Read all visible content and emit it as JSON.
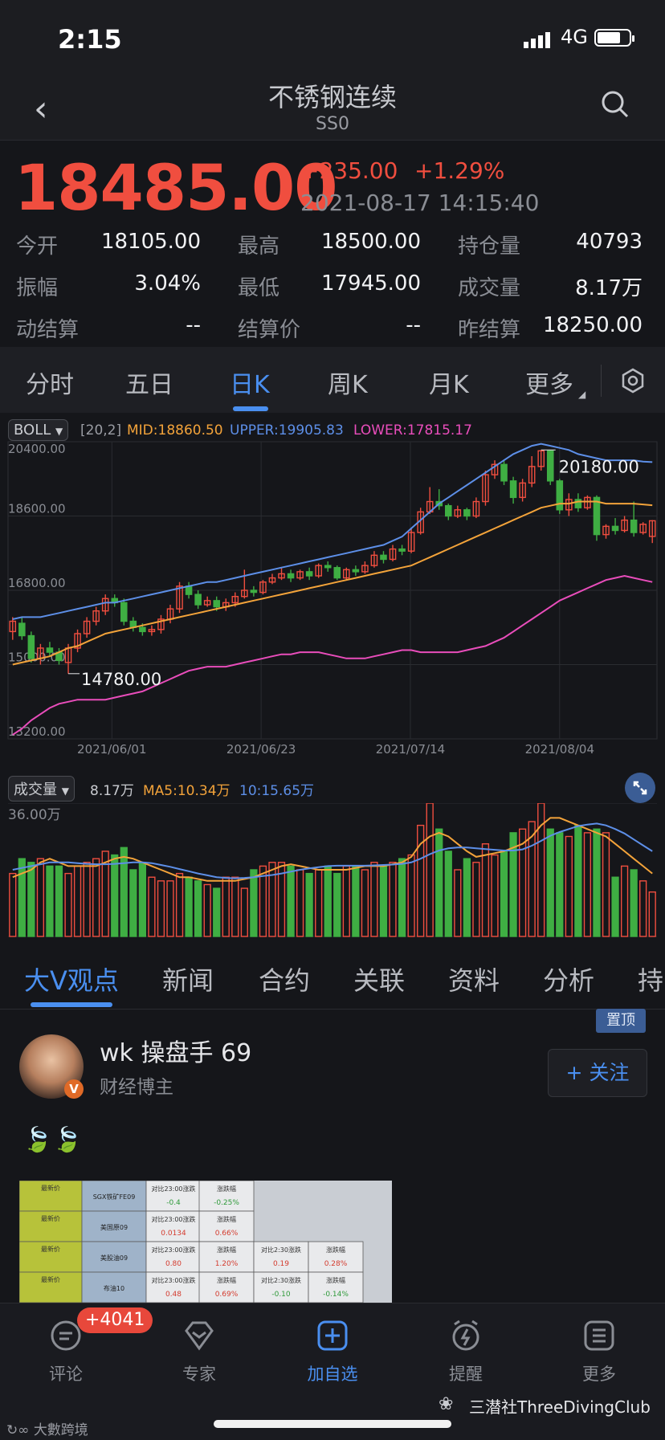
{
  "status": {
    "time": "2:15",
    "network": "4G"
  },
  "header": {
    "title": "不锈钢连续",
    "code": "SS0"
  },
  "quote": {
    "price": "18485.00",
    "change": "+235.00",
    "change_pct": "+1.29%",
    "datetime": "2021-08-17 14:15:40",
    "stats": [
      {
        "label": "今开",
        "value": "18105.00"
      },
      {
        "label": "最高",
        "value": "18500.00"
      },
      {
        "label": "持仓量",
        "value": "40793"
      },
      {
        "label": "振幅",
        "value": "3.04%"
      },
      {
        "label": "最低",
        "value": "17945.00"
      },
      {
        "label": "成交量",
        "value": "8.17万"
      },
      {
        "label": "动结算",
        "value": "--"
      },
      {
        "label": "结算价",
        "value": "--"
      },
      {
        "label": "昨结算",
        "value": "18250.00"
      }
    ]
  },
  "tabs": [
    "分时",
    "五日",
    "日K",
    "周K",
    "月K",
    "更多"
  ],
  "active_tab": "日K",
  "boll": {
    "name": "BOLL",
    "params": "[20,2]",
    "mid": "MID:18860.50",
    "upper": "UPPER:19905.83",
    "lower": "LOWER:17815.17"
  },
  "colors": {
    "up": "#f04e3f",
    "down": "#3fae43",
    "mid": "#f3a33a",
    "upper": "#5d8fe8",
    "lower": "#e94dbb",
    "accent": "#4a8ff0"
  },
  "volume_bar": {
    "name": "成交量",
    "value": "8.17万",
    "ma5": "MA5:10.34万",
    "ma10": "10:15.65万",
    "max_label": "36.00万"
  },
  "chart_data": {
    "type": "candlestick",
    "y_ticks": [
      "20400.00",
      "18600.00",
      "16800.00",
      "15000.00",
      "13200.00"
    ],
    "y_range": [
      13200,
      20400
    ],
    "x_ticks": [
      "2021/06/01",
      "2021/06/23",
      "2021/07/14",
      "2021/08/04"
    ],
    "high_label": "20180.00",
    "low_label": "14780.00",
    "candles": [
      [
        15800,
        16050,
        15600,
        16150
      ],
      [
        16000,
        15700,
        15600,
        16150
      ],
      [
        15700,
        15150,
        15050,
        15800
      ],
      [
        15150,
        15400,
        15000,
        15500
      ],
      [
        15400,
        15300,
        15200,
        15550
      ],
      [
        15300,
        15100,
        15000,
        15400
      ],
      [
        15050,
        15400,
        14780,
        15500
      ],
      [
        15400,
        15750,
        15300,
        15850
      ],
      [
        15750,
        16050,
        15650,
        16150
      ],
      [
        16050,
        16300,
        15950,
        16400
      ],
      [
        16300,
        16600,
        16200,
        16700
      ],
      [
        16600,
        16500,
        16400,
        16700
      ],
      [
        16500,
        16050,
        15950,
        16600
      ],
      [
        16050,
        15900,
        15800,
        16150
      ],
      [
        15900,
        15800,
        15700,
        16000
      ],
      [
        15800,
        15850,
        15700,
        15950
      ],
      [
        15850,
        16100,
        15750,
        16200
      ],
      [
        16100,
        16350,
        16000,
        16450
      ],
      [
        16350,
        16900,
        16250,
        17000
      ],
      [
        16900,
        16700,
        16600,
        17000
      ],
      [
        16700,
        16450,
        16350,
        16800
      ],
      [
        16450,
        16550,
        16400,
        16650
      ],
      [
        16550,
        16400,
        16300,
        16650
      ],
      [
        16400,
        16500,
        16300,
        16600
      ],
      [
        16500,
        16650,
        16400,
        16750
      ],
      [
        16650,
        16800,
        16600,
        17300
      ],
      [
        16800,
        16750,
        16650,
        16900
      ],
      [
        16750,
        17000,
        16700,
        17050
      ],
      [
        17000,
        17100,
        16950,
        17200
      ],
      [
        17100,
        17200,
        17050,
        17350
      ],
      [
        17200,
        17100,
        17000,
        17300
      ],
      [
        17100,
        17250,
        17050,
        17300
      ],
      [
        17250,
        17150,
        17050,
        17350
      ],
      [
        17150,
        17400,
        17100,
        17450
      ],
      [
        17400,
        17350,
        17250,
        17500
      ],
      [
        17350,
        17100,
        17050,
        17400
      ],
      [
        17100,
        17300,
        17050,
        17350
      ],
      [
        17300,
        17250,
        17150,
        17400
      ],
      [
        17250,
        17400,
        17200,
        17500
      ],
      [
        17400,
        17650,
        17350,
        17750
      ],
      [
        17650,
        17550,
        17450,
        17750
      ],
      [
        17550,
        17800,
        17500,
        17900
      ],
      [
        17800,
        17750,
        17650,
        17900
      ],
      [
        17750,
        18200,
        17700,
        18300
      ],
      [
        18200,
        18700,
        18150,
        18800
      ],
      [
        18700,
        18950,
        18650,
        19300
      ],
      [
        18950,
        18850,
        18750,
        19250
      ],
      [
        18850,
        18600,
        18500,
        18900
      ],
      [
        18600,
        18750,
        18550,
        18850
      ],
      [
        18750,
        18600,
        18500,
        18800
      ],
      [
        18600,
        18950,
        18550,
        19050
      ],
      [
        18950,
        19600,
        18850,
        19700
      ],
      [
        19600,
        19850,
        19500,
        19950
      ],
      [
        19850,
        19450,
        19350,
        19950
      ],
      [
        19450,
        19050,
        18900,
        19550
      ],
      [
        19050,
        19400,
        18950,
        19500
      ],
      [
        19400,
        19800,
        19300,
        20050
      ],
      [
        19800,
        20180,
        19700,
        20200
      ],
      [
        20180,
        19450,
        19350,
        20200
      ],
      [
        19450,
        18750,
        18650,
        19500
      ],
      [
        18750,
        19000,
        18600,
        19150
      ],
      [
        19000,
        18800,
        18700,
        19150
      ],
      [
        18800,
        19050,
        18750,
        19100
      ],
      [
        19050,
        18150,
        18000,
        19100
      ],
      [
        18150,
        18350,
        18050,
        18400
      ],
      [
        18350,
        18250,
        18150,
        18550
      ],
      [
        18250,
        18500,
        18200,
        18600
      ],
      [
        18500,
        18200,
        18100,
        18950
      ],
      [
        18200,
        18400,
        18150,
        18450
      ],
      [
        18105,
        18485,
        17945,
        18500
      ]
    ],
    "mid_line": [
      15000,
      15050,
      15100,
      15150,
      15200,
      15300,
      15400,
      15450,
      15550,
      15650,
      15750,
      15800,
      15850,
      15900,
      15950,
      16000,
      16050,
      16100,
      16150,
      16200,
      16250,
      16300,
      16350,
      16400,
      16450,
      16500,
      16550,
      16600,
      16650,
      16700,
      16750,
      16800,
      16850,
      16900,
      16950,
      17000,
      17050,
      17100,
      17150,
      17200,
      17250,
      17300,
      17350,
      17400,
      17500,
      17600,
      17700,
      17800,
      17900,
      18000,
      18100,
      18200,
      18300,
      18400,
      18500,
      18600,
      18700,
      18800,
      18850,
      18900,
      18900,
      18950,
      18950,
      18950,
      18900,
      18900,
      18900,
      18900,
      18880,
      18860
    ],
    "upper_line": [
      16100,
      16150,
      16150,
      16150,
      16200,
      16250,
      16300,
      16350,
      16400,
      16450,
      16500,
      16500,
      16550,
      16600,
      16650,
      16700,
      16750,
      16800,
      16850,
      16900,
      16950,
      17000,
      17000,
      17050,
      17100,
      17150,
      17200,
      17250,
      17300,
      17350,
      17400,
      17450,
      17500,
      17550,
      17600,
      17650,
      17700,
      17750,
      17800,
      17850,
      17900,
      18000,
      18100,
      18300,
      18500,
      18700,
      18900,
      19050,
      19200,
      19350,
      19500,
      19650,
      19800,
      19950,
      20100,
      20200,
      20300,
      20350,
      20300,
      20250,
      20200,
      20100,
      20050,
      20000,
      19950,
      19950,
      19950,
      19950,
      19920,
      19905
    ],
    "lower_line": [
      13300,
      13450,
      13650,
      13800,
      13950,
      14050,
      14100,
      14150,
      14150,
      14150,
      14150,
      14200,
      14250,
      14300,
      14350,
      14450,
      14550,
      14650,
      14750,
      14850,
      14900,
      14950,
      14950,
      14950,
      15000,
      15050,
      15100,
      15150,
      15200,
      15250,
      15250,
      15300,
      15300,
      15300,
      15250,
      15200,
      15150,
      15150,
      15150,
      15200,
      15250,
      15300,
      15350,
      15350,
      15300,
      15300,
      15300,
      15300,
      15300,
      15350,
      15400,
      15450,
      15550,
      15650,
      15800,
      15950,
      16100,
      16250,
      16400,
      16550,
      16650,
      16750,
      16850,
      16950,
      17050,
      17100,
      17150,
      17100,
      17050,
      17000
    ]
  },
  "volume_data": {
    "max": 360000,
    "bars": [
      170000,
      210000,
      200000,
      210000,
      190000,
      190000,
      170000,
      190000,
      200000,
      210000,
      230000,
      220000,
      240000,
      180000,
      200000,
      160000,
      150000,
      150000,
      170000,
      160000,
      150000,
      140000,
      130000,
      160000,
      160000,
      130000,
      180000,
      190000,
      200000,
      200000,
      190000,
      180000,
      170000,
      180000,
      190000,
      170000,
      190000,
      190000,
      180000,
      200000,
      190000,
      200000,
      210000,
      220000,
      300000,
      360000,
      290000,
      230000,
      180000,
      210000,
      200000,
      250000,
      220000,
      230000,
      280000,
      290000,
      310000,
      360000,
      290000,
      280000,
      270000,
      300000,
      280000,
      290000,
      280000,
      160000,
      190000,
      180000,
      150000,
      120000
    ],
    "ma5": [
      160000,
      170000,
      180000,
      200000,
      210000,
      200000,
      190000,
      190000,
      190000,
      190000,
      200000,
      210000,
      215000,
      210000,
      200000,
      190000,
      180000,
      170000,
      160000,
      160000,
      155000,
      150000,
      150000,
      150000,
      150000,
      155000,
      160000,
      170000,
      180000,
      190000,
      195000,
      190000,
      185000,
      180000,
      180000,
      180000,
      180000,
      185000,
      190000,
      190000,
      190000,
      195000,
      200000,
      215000,
      250000,
      270000,
      280000,
      270000,
      250000,
      230000,
      215000,
      220000,
      225000,
      230000,
      240000,
      250000,
      270000,
      300000,
      320000,
      320000,
      310000,
      300000,
      290000,
      280000,
      270000,
      250000,
      230000,
      210000,
      190000,
      170000
    ],
    "ma10": [
      180000,
      185000,
      190000,
      195000,
      200000,
      200000,
      200000,
      198000,
      196000,
      195000,
      195000,
      196000,
      198000,
      200000,
      200000,
      198000,
      193000,
      188000,
      182000,
      176000,
      170000,
      165000,
      160000,
      158000,
      157000,
      158000,
      160000,
      163000,
      166000,
      170000,
      175000,
      180000,
      184000,
      187000,
      190000,
      191000,
      191000,
      191000,
      191000,
      192000,
      193000,
      194000,
      196000,
      200000,
      210000,
      222000,
      232000,
      238000,
      240000,
      240000,
      238000,
      236000,
      234000,
      232000,
      232000,
      235000,
      245000,
      258000,
      272000,
      282000,
      290000,
      298000,
      302000,
      305000,
      300000,
      290000,
      278000,
      262000,
      246000,
      230000
    ]
  },
  "content_tabs": [
    "大V观点",
    "新闻",
    "合约",
    "关联",
    "资料",
    "分析",
    "持"
  ],
  "post": {
    "pinned": "置顶",
    "username": "wk 操盘手 69",
    "role": "财经博主",
    "follow": "+ 关注",
    "verified": "V",
    "leaves": "🍃🍃"
  },
  "thumb_table": {
    "rows": [
      {
        "name": "SGX铁矿FE09",
        "l1": "对比23:00涨跌",
        "l2": "涨跌幅",
        "v1": "-0.4",
        "v2": "-0.25%"
      },
      {
        "name": "美国原09",
        "l1": "对比23:00涨跌",
        "l2": "涨跌幅",
        "v1": "0.0134",
        "v2": "0.66%"
      },
      {
        "name": "美股油09",
        "l1": "对比23:00涨跌",
        "l2": "涨跌幅",
        "v1": "0.80",
        "v2": "1.20%",
        "l3": "对比2:30涨跌",
        "l4": "涨跌幅",
        "v3": "0.19",
        "v4": "0.28%"
      },
      {
        "name": "布油10",
        "l1": "对比23:00涨跌",
        "l2": "涨跌幅",
        "v1": "0.48",
        "v2": "0.69%",
        "l3": "对比2:30涨跌",
        "l4": "涨跌幅",
        "v3": "-0.10",
        "v4": "-0.14%"
      }
    ],
    "side": [
      "最新价",
      "最新价",
      "最新价",
      "最新价"
    ]
  },
  "bottom_nav": [
    {
      "label": "评论",
      "icon": "comment-icon"
    },
    {
      "label": "专家",
      "icon": "expert-icon"
    },
    {
      "label": "加自选",
      "icon": "add-watch-icon"
    },
    {
      "label": "提醒",
      "icon": "alarm-icon"
    },
    {
      "label": "更多",
      "icon": "more-icon"
    }
  ],
  "comment_badge": "+4041",
  "watermark": {
    "wechat": "三潜社ThreeDivingClub",
    "corner": "大數跨境"
  }
}
